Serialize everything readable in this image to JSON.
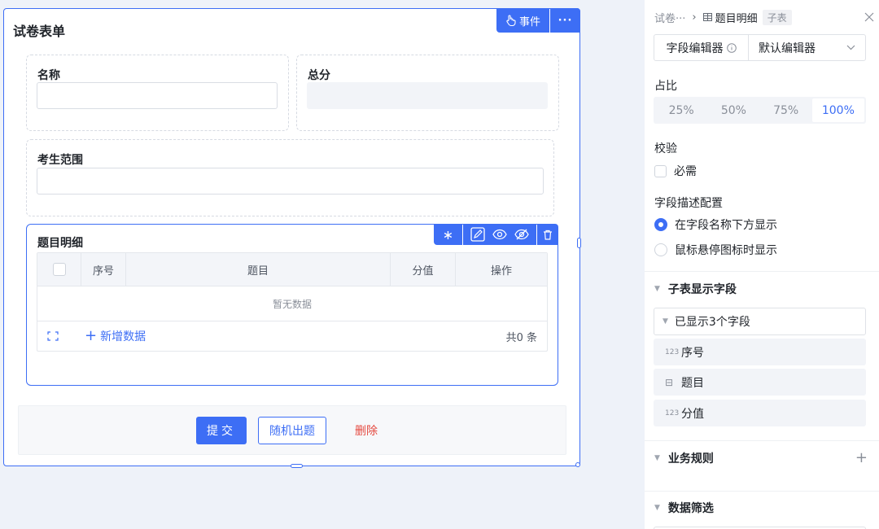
{
  "form": {
    "title": "试卷表单",
    "event_label": "事件",
    "more_label": "···",
    "fields": {
      "name_label": "名称",
      "total_label": "总分",
      "scope_label": "考生范围"
    },
    "subtable": {
      "label": "题目明细",
      "columns": [
        "序号",
        "题目",
        "分值",
        "操作"
      ],
      "empty_text": "暂无数据",
      "add_label": "新增数据",
      "count_text": "共0 条"
    },
    "buttons": {
      "submit": "提交",
      "random": "随机出题",
      "delete": "删除"
    }
  },
  "panel": {
    "breadcrumb": {
      "parent": "试卷···",
      "current": "题目明细",
      "tag": "子表"
    },
    "editor": {
      "label": "字段编辑器",
      "value": "默认编辑器"
    },
    "ratio": {
      "label": "占比",
      "options": [
        "25%",
        "50%",
        "75%",
        "100%"
      ],
      "selected": "100%"
    },
    "validation": {
      "label": "校验",
      "required_label": "必需",
      "required_checked": false
    },
    "description": {
      "label": "字段描述配置",
      "options": [
        "在字段名称下方显示",
        "鼠标悬停图标时显示"
      ],
      "selected": "在字段名称下方显示"
    },
    "display_fields": {
      "label": "子表显示字段",
      "shown_label": "已显示3个字段",
      "items": [
        {
          "icon": "number-icon",
          "glyph": "123",
          "label": "序号"
        },
        {
          "icon": "text-field-icon",
          "glyph": "⊟",
          "label": "题目"
        },
        {
          "icon": "number-icon",
          "glyph": "123",
          "label": "分值"
        }
      ]
    },
    "business_rules_label": "业务规则",
    "data_filter_label": "数据筛选"
  },
  "colors": {
    "accent": "#3d6ef5",
    "danger": "#e5483e",
    "canvas_bg": "#eef2f9"
  }
}
